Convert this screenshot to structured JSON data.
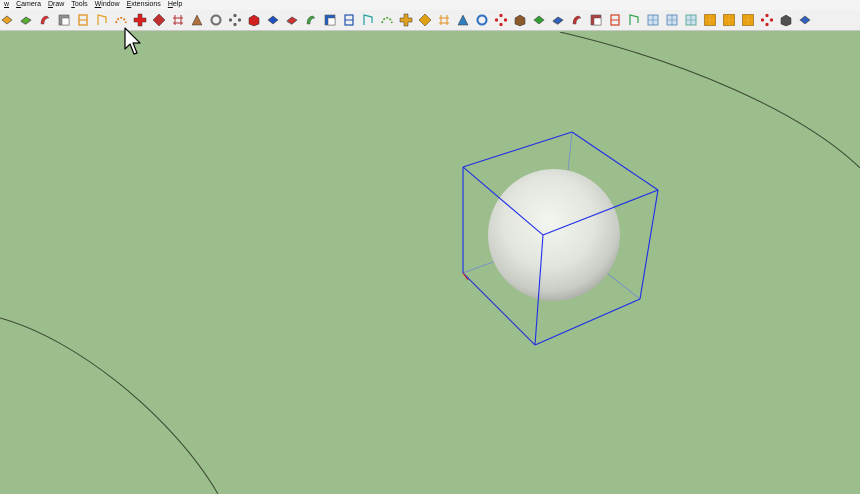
{
  "menubar": {
    "items": [
      "w",
      "Camera",
      "Draw",
      "Tools",
      "Window",
      "Extensions",
      "Help"
    ]
  },
  "toolbar": {
    "tools": [
      {
        "name": "style-xray-icon",
        "color": "#e8a020"
      },
      {
        "name": "style-shaded-icon",
        "color": "#58b030"
      },
      {
        "name": "style-textured-icon",
        "color": "#d83030"
      },
      {
        "name": "style-monochrome-icon",
        "color": "#909090"
      },
      {
        "name": "follow-me-icon",
        "color": "#e08a10"
      },
      {
        "name": "intersect-faces-icon",
        "color": "#e0a020"
      },
      {
        "name": "outer-shell-icon",
        "color": "#e07010"
      },
      {
        "name": "section-plane-icon",
        "color": "#e02020"
      },
      {
        "name": "section-fill-icon",
        "color": "#c03030"
      },
      {
        "name": "section-display-icon",
        "color": "#b03030"
      },
      {
        "name": "sandbox-from-contours-icon",
        "color": "#b07040"
      },
      {
        "name": "sandbox-from-scratch-icon",
        "color": "#707070"
      },
      {
        "name": "smoove-icon",
        "color": "#606060"
      },
      {
        "name": "bezier-curve-icon",
        "color": "#d02020"
      },
      {
        "name": "curviloft-icon",
        "color": "#2050c0"
      },
      {
        "name": "add-detail-icon",
        "color": "#d03030"
      },
      {
        "name": "flip-edge-icon",
        "color": "#40a040"
      },
      {
        "name": "join-pushpull-icon",
        "color": "#2060c0"
      },
      {
        "name": "grid-tool-icon",
        "color": "#2050b0"
      },
      {
        "name": "vertex-tools-icon",
        "color": "#20a0a0"
      },
      {
        "name": "soap-skin-icon",
        "color": "#50a030"
      },
      {
        "name": "shape-bender-icon",
        "color": "#e0a020"
      },
      {
        "name": "fredo-scale-icon",
        "color": "#e0a010"
      },
      {
        "name": "round-corner-icon",
        "color": "#e09020"
      },
      {
        "name": "quad-face-icon",
        "color": "#3080c0"
      },
      {
        "name": "lines-to-tubes-icon",
        "color": "#3070c0"
      },
      {
        "name": "undo-icon",
        "color": "#d02020"
      },
      {
        "name": "cleanup-icon",
        "color": "#8b5a2b"
      },
      {
        "name": "material-replacer-icon",
        "color": "#30a030"
      },
      {
        "name": "component-stringer-icon",
        "color": "#3060c0"
      },
      {
        "name": "skimp-icon",
        "color": "#c03030"
      },
      {
        "name": "profile-builder-icon",
        "color": "#b04040"
      },
      {
        "name": "solid-inspector-icon",
        "color": "#d04020"
      },
      {
        "name": "make-faces-icon",
        "color": "#30a050"
      },
      {
        "name": "wireframe-a-icon",
        "color": "#5080b0"
      },
      {
        "name": "wireframe-b-icon",
        "color": "#5080b0"
      },
      {
        "name": "wireframe-c-icon",
        "color": "#40a080"
      },
      {
        "name": "panel-a-icon",
        "color": "#e8a010"
      },
      {
        "name": "panel-b-icon",
        "color": "#e8a010"
      },
      {
        "name": "panel-c-icon",
        "color": "#e8a010"
      },
      {
        "name": "point-cloud-icon",
        "color": "#d02020"
      },
      {
        "name": "dashed-circle-icon",
        "color": "#505050"
      },
      {
        "name": "selection-toys-icon",
        "color": "#3060c0"
      }
    ]
  },
  "scene": {
    "background": "#9cbd8c",
    "box_edge_color": "#1e2ee8",
    "sphere_color": "#e4e8e0",
    "curve_color": "#3a4a32"
  }
}
